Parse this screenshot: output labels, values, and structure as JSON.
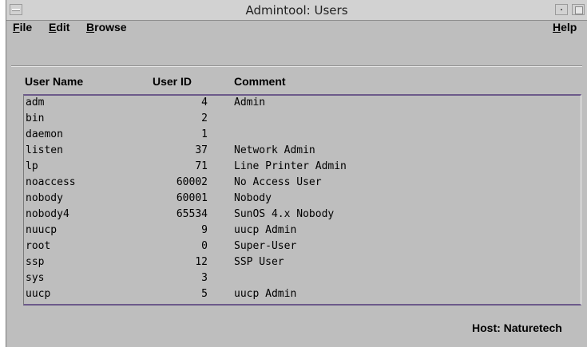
{
  "window": {
    "title": "Admintool: Users"
  },
  "menubar": {
    "file": {
      "underline": "F",
      "rest": "ile"
    },
    "edit": {
      "underline": "E",
      "rest": "dit"
    },
    "browse": {
      "underline": "B",
      "rest": "rowse"
    },
    "help": {
      "underline": "H",
      "rest": "elp"
    }
  },
  "columns": {
    "name": "User Name",
    "uid": "User ID",
    "comment": "Comment"
  },
  "users": [
    {
      "name": "adm",
      "uid": "4",
      "comment": "Admin"
    },
    {
      "name": "bin",
      "uid": "2",
      "comment": ""
    },
    {
      "name": "daemon",
      "uid": "1",
      "comment": ""
    },
    {
      "name": "listen",
      "uid": "37",
      "comment": "Network Admin"
    },
    {
      "name": "lp",
      "uid": "71",
      "comment": "Line Printer Admin"
    },
    {
      "name": "noaccess",
      "uid": "60002",
      "comment": "No Access User"
    },
    {
      "name": "nobody",
      "uid": "60001",
      "comment": "Nobody"
    },
    {
      "name": "nobody4",
      "uid": "65534",
      "comment": "SunOS 4.x Nobody"
    },
    {
      "name": "nuucp",
      "uid": "9",
      "comment": "uucp Admin"
    },
    {
      "name": "root",
      "uid": "0",
      "comment": "Super-User"
    },
    {
      "name": "ssp",
      "uid": "12",
      "comment": "SSP User"
    },
    {
      "name": "sys",
      "uid": "3",
      "comment": ""
    },
    {
      "name": "uucp",
      "uid": "5",
      "comment": "uucp Admin"
    }
  ],
  "footer": {
    "host": "Host: Naturetech"
  }
}
